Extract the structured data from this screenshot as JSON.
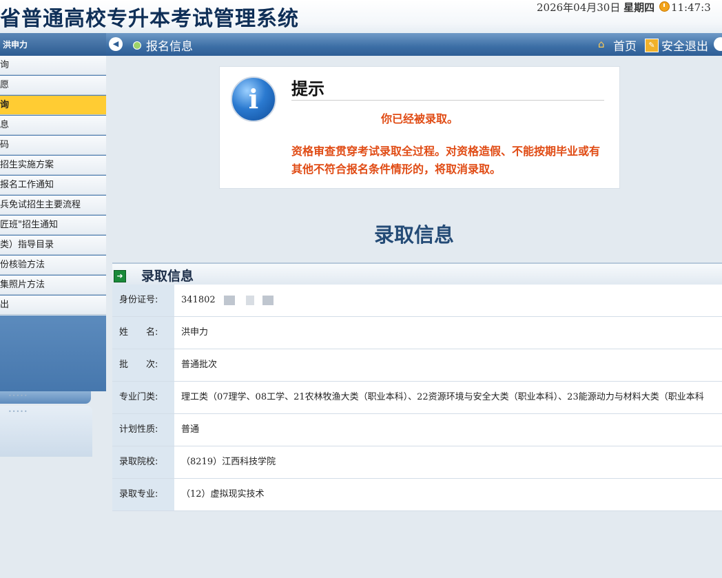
{
  "header": {
    "system_title": "省普通高校专升本考试管理系统",
    "date": "2026年04月30日",
    "weekday": "星期四",
    "time": "11:47:3"
  },
  "sidebar": {
    "user_name": "洪申力",
    "items": [
      {
        "label": "询",
        "active": false
      },
      {
        "label": "愿",
        "active": false
      },
      {
        "label": "询",
        "active": true
      },
      {
        "label": "息",
        "active": false
      },
      {
        "label": "码",
        "active": false
      },
      {
        "label": "招生实施方案",
        "active": false
      },
      {
        "label": "报名工作通知",
        "active": false
      },
      {
        "label": "兵免试招生主要流程",
        "active": false
      },
      {
        "label": "匠班\"招生通知",
        "active": false
      },
      {
        "label": "类）指导目录",
        "active": false
      },
      {
        "label": "份核验方法",
        "active": false
      },
      {
        "label": "集照片方法",
        "active": false
      },
      {
        "label": "出",
        "active": false
      }
    ]
  },
  "topbar": {
    "location": "报名信息",
    "home": "首页",
    "logout": "安全退出"
  },
  "notice": {
    "title": "提示",
    "message": "你已经被录取。",
    "description": "资格审查贯穿考试录取全过程。对资格造假、不能按期毕业或有其他不符合报名条件情形的，将取消录取。"
  },
  "section_heading": "录取信息",
  "admission_panel": {
    "title": "录取信息",
    "rows": [
      {
        "label": "身份证号:",
        "value": "341802"
      },
      {
        "label": "姓　　名:",
        "value": "洪申力"
      },
      {
        "label": "批　　次:",
        "value": "普通批次"
      },
      {
        "label": "专业门类:",
        "value": "理工类（07理学、08工学、21农林牧渔大类（职业本科）、22资源环境与安全大类（职业本科）、23能源动力与材料大类（职业本科"
      },
      {
        "label": "计划性质:",
        "value": "普通"
      },
      {
        "label": "录取院校:",
        "value": "（8219）江西科技学院"
      },
      {
        "label": "录取专业:",
        "value": "（12）虚拟现实技术"
      }
    ]
  },
  "colors": {
    "primary_blue": "#3c6ea5",
    "active_menu": "#ffcc33",
    "alert_text": "#e04b14"
  }
}
